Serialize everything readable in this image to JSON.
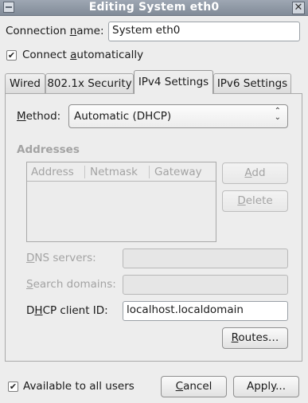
{
  "window": {
    "title": "Editing System eth0"
  },
  "connection": {
    "name_label_pre": "Connection ",
    "name_label_mn": "n",
    "name_label_post": "ame:",
    "name_value": "System eth0",
    "auto_pre": "Connect ",
    "auto_mn": "a",
    "auto_post": "utomatically",
    "auto_checked": true
  },
  "tabs": [
    {
      "label": "Wired"
    },
    {
      "label": "802.1x Security"
    },
    {
      "label": "IPv4 Settings"
    },
    {
      "label": "IPv6 Settings"
    }
  ],
  "active_tab": "IPv4 Settings",
  "ipv4": {
    "method_mn": "M",
    "method_rest": "ethod:",
    "method_value": "Automatic (DHCP)",
    "addresses_heading": "Addresses",
    "columns": [
      "Address",
      "Netmask",
      "Gateway"
    ],
    "add_mn": "A",
    "add_rest": "dd",
    "delete_mn": "D",
    "delete_rest": "elete",
    "dns_mn": "D",
    "dns_rest": "NS servers:",
    "dns_value": "",
    "search_mn": "S",
    "search_rest": "earch domains:",
    "search_value": "",
    "dhcp_pre": "D",
    "dhcp_mn": "H",
    "dhcp_post": "CP client ID:",
    "dhcp_value": "localhost.localdomain",
    "routes_mn": "R",
    "routes_rest": "outes…"
  },
  "footer": {
    "all_users_label": "Available to all users",
    "all_users_checked": true,
    "cancel_mn": "C",
    "cancel_rest": "ancel",
    "apply_label": "Apply..."
  }
}
